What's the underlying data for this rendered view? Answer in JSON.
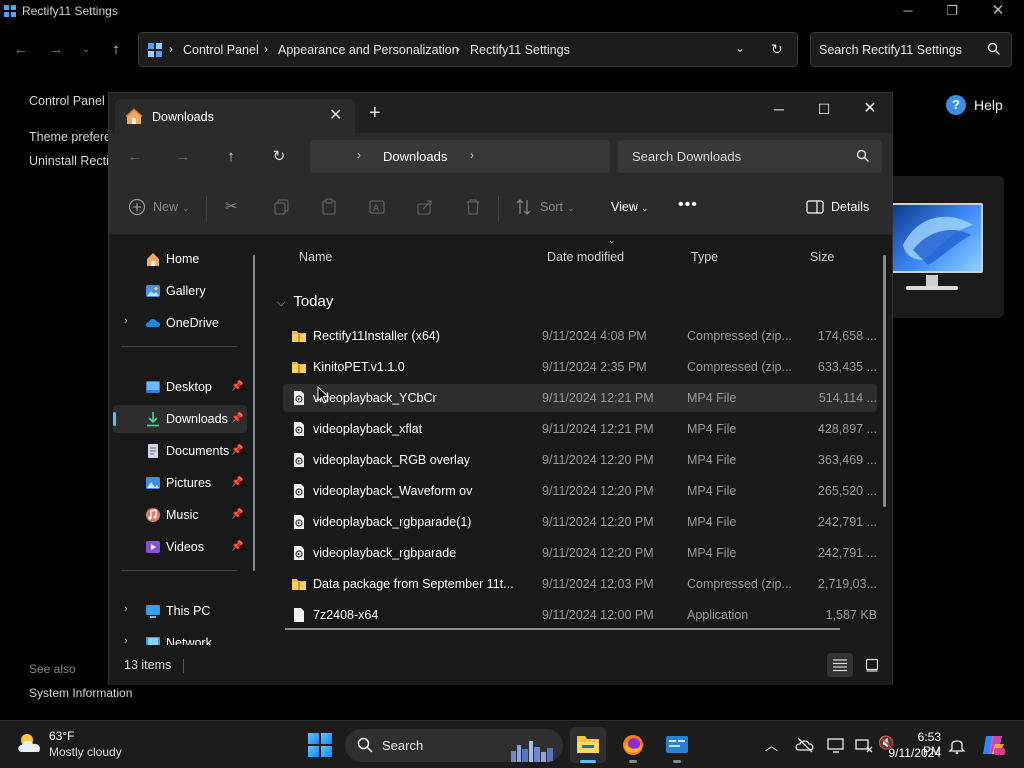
{
  "control_panel": {
    "title": "Rectify11 Settings",
    "breadcrumb": [
      "Control Panel",
      "Appearance and Personalization",
      "Rectify11 Settings"
    ],
    "search_placeholder": "Search Rectify11 Settings",
    "left_links": [
      "Control Panel H",
      "Theme prefere",
      "Uninstall Rectif"
    ],
    "see_also": "See also",
    "see_also_link": "System Information",
    "help": "Help"
  },
  "explorer": {
    "tab_title": "Downloads",
    "address_folder": "Downloads",
    "search_placeholder": "Search Downloads",
    "commands": {
      "new": "New",
      "sort": "Sort",
      "view": "View",
      "details": "Details"
    },
    "sidebar": [
      {
        "label": "Home",
        "icon": "home-icon",
        "group": "top"
      },
      {
        "label": "Gallery",
        "icon": "gallery-icon",
        "group": "top"
      },
      {
        "label": "OneDrive",
        "icon": "onedrive-icon",
        "group": "top",
        "expandable": true
      },
      {
        "label": "Desktop",
        "icon": "desktop-icon",
        "group": "pinned",
        "pinned": true
      },
      {
        "label": "Downloads",
        "icon": "download-icon",
        "group": "pinned",
        "pinned": true,
        "selected": true
      },
      {
        "label": "Documents",
        "icon": "documents-icon",
        "group": "pinned",
        "pinned": true
      },
      {
        "label": "Pictures",
        "icon": "pictures-icon",
        "group": "pinned",
        "pinned": true
      },
      {
        "label": "Music",
        "icon": "music-icon",
        "group": "pinned",
        "pinned": true
      },
      {
        "label": "Videos",
        "icon": "videos-icon",
        "group": "pinned",
        "pinned": true
      },
      {
        "label": "This PC",
        "icon": "this-pc-icon",
        "group": "bottom",
        "expandable": true
      },
      {
        "label": "Network",
        "icon": "network-icon",
        "group": "bottom",
        "expandable": true
      }
    ],
    "columns": {
      "name": "Name",
      "date": "Date modified",
      "type": "Type",
      "size": "Size"
    },
    "group_label": "Today",
    "files": [
      {
        "name": "Rectify11Installer (x64)",
        "date": "9/11/2024 4:08 PM",
        "type": "Compressed (zip...",
        "size": "174,658 ...",
        "kind": "zip"
      },
      {
        "name": "KinitoPET.v1.1.0",
        "date": "9/11/2024 2:35 PM",
        "type": "Compressed (zip...",
        "size": "633,435 ...",
        "kind": "zip"
      },
      {
        "name": "videoplayback_YCbCr",
        "date": "9/11/2024 12:21 PM",
        "type": "MP4 File",
        "size": "514,114 ...",
        "kind": "video",
        "hover": true
      },
      {
        "name": "videoplayback_xflat",
        "date": "9/11/2024 12:21 PM",
        "type": "MP4 File",
        "size": "428,897 ...",
        "kind": "video"
      },
      {
        "name": "videoplayback_RGB overlay",
        "date": "9/11/2024 12:20 PM",
        "type": "MP4 File",
        "size": "363,469 ...",
        "kind": "video"
      },
      {
        "name": "videoplayback_Waveform ov",
        "date": "9/11/2024 12:20 PM",
        "type": "MP4 File",
        "size": "265,520 ...",
        "kind": "video"
      },
      {
        "name": "videoplayback_rgbparade(1)",
        "date": "9/11/2024 12:20 PM",
        "type": "MP4 File",
        "size": "242,791 ...",
        "kind": "video"
      },
      {
        "name": "videoplayback_rgbparade",
        "date": "9/11/2024 12:20 PM",
        "type": "MP4 File",
        "size": "242,791 ...",
        "kind": "video"
      },
      {
        "name": "Data package from September 11t...",
        "date": "9/11/2024 12:03 PM",
        "type": "Compressed (zip...",
        "size": "2,719,03...",
        "kind": "zip"
      },
      {
        "name": "7z2408-x64",
        "date": "9/11/2024 12:00 PM",
        "type": "Application",
        "size": "1,587 KB",
        "kind": "app"
      }
    ],
    "status_count": "13 items"
  },
  "taskbar": {
    "weather_temp": "63°F",
    "weather_cond": "Mostly cloudy",
    "search_label": "Search",
    "time": "6:53 PM",
    "date": "9/11/2024"
  },
  "colors": {
    "accent": "#4cc2ff",
    "folder": "#f2c744",
    "help_blue": "#3c8ee8"
  }
}
